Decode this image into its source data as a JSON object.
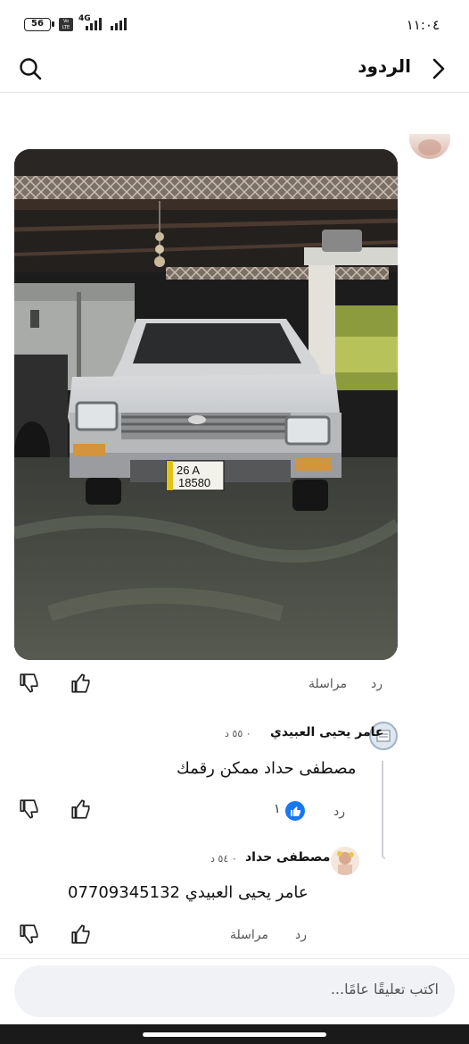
{
  "status_bar": {
    "battery": "56",
    "network": "4G",
    "time": "١١:٠٤"
  },
  "header": {
    "title": "الردود"
  },
  "post_actions": {
    "reply": "رد",
    "message": "مراسلة"
  },
  "comments": [
    {
      "author": "عامر يحيى العبيدي",
      "meta": "٠ ٥٥ د",
      "text": "مصطفى حداد  ممكن رقمك",
      "reply": "رد",
      "like_count": "١"
    },
    {
      "author": "مصطفى حداد",
      "meta": "٠ ٥٤ د",
      "text": "عامر يحيى العبيدي 07709345132",
      "reply": "رد",
      "message": "مراسلة"
    }
  ],
  "photo": {
    "plate_top": "26  A",
    "plate_bottom": "18580"
  },
  "composer": {
    "placeholder": "اكتب تعليقًا عامًا..."
  },
  "icons": [
    "search-icon",
    "chevron-right-icon",
    "thumbs-up-icon",
    "thumbs-down-icon",
    "like-reaction-icon"
  ]
}
